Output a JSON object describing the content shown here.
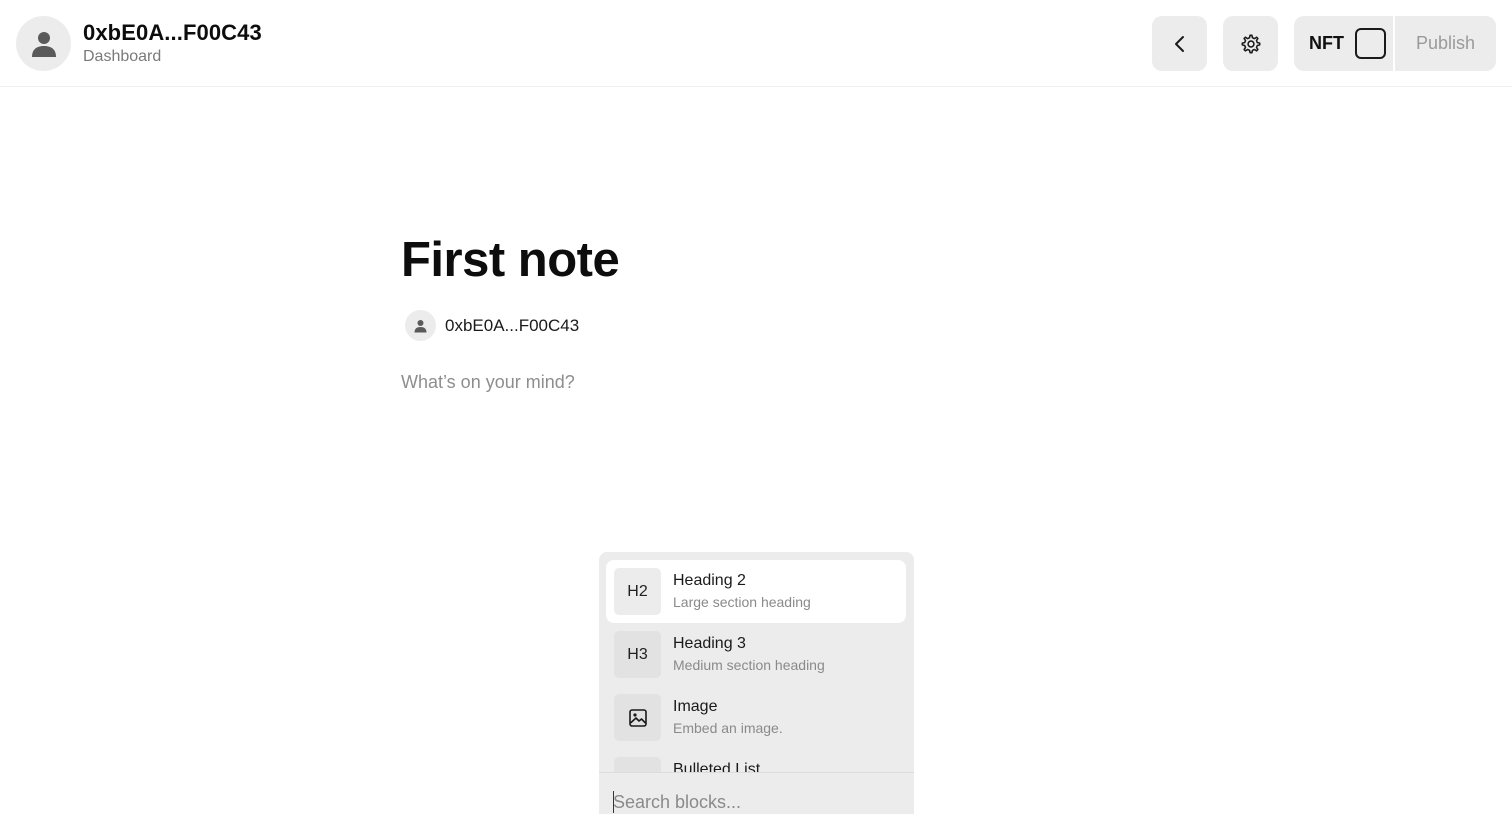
{
  "header": {
    "user_address": "0xbE0A...F00C43",
    "subtitle": "Dashboard",
    "nft_label": "NFT",
    "publish_label": "Publish"
  },
  "note": {
    "title": "First note",
    "author": "0xbE0A...F00C43",
    "body_placeholder": "What’s on your mind?"
  },
  "block_menu": {
    "items": [
      {
        "icon": "H2",
        "name": "Heading 2",
        "description": "Large section heading",
        "selected": true
      },
      {
        "icon": "H3",
        "name": "Heading 3",
        "description": "Medium section heading",
        "selected": false
      },
      {
        "icon": "image-icon",
        "name": "Image",
        "description": "Embed an image.",
        "selected": false
      },
      {
        "icon": "bulleted-list-icon",
        "name": "Bulleted List",
        "description": "",
        "selected": false
      }
    ],
    "search_placeholder": "Search blocks..."
  },
  "colors": {
    "surface": "#ececec",
    "text": "#111111",
    "muted": "#8a8a8a"
  }
}
